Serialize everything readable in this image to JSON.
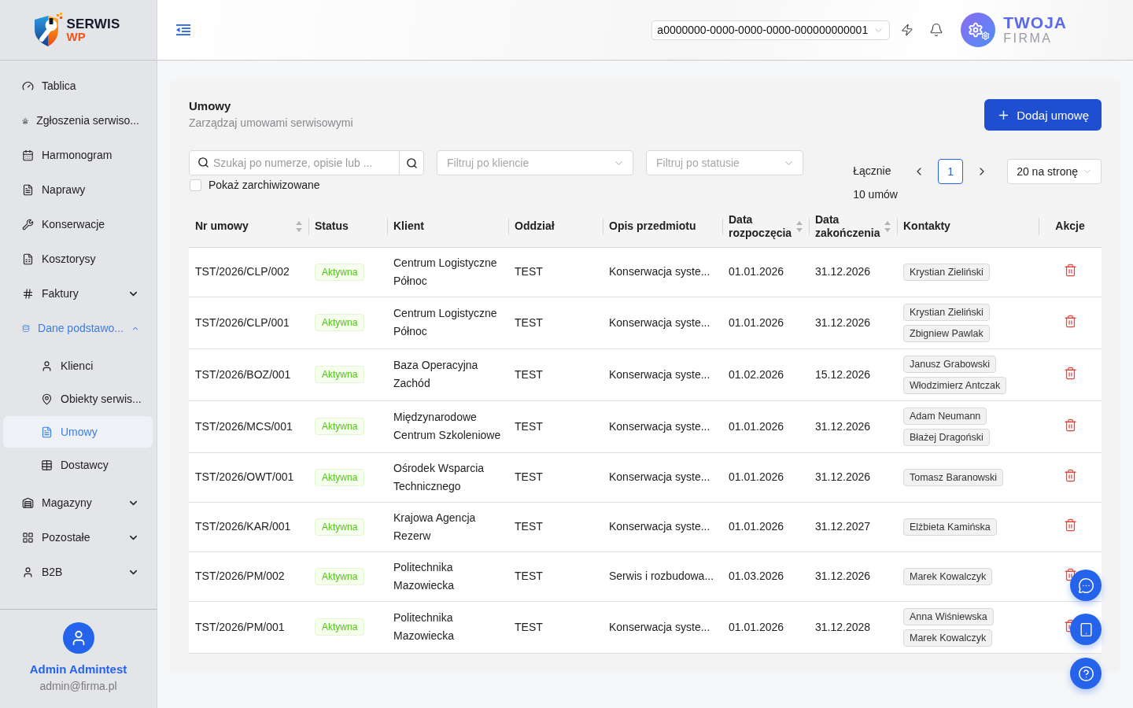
{
  "logo": {
    "title": "SERWIS",
    "subtitle": "WP"
  },
  "sidebar": {
    "items": [
      {
        "label": "Tablica",
        "kind": "link",
        "selected": false
      },
      {
        "label": "Zgłoszenia serwiso...",
        "kind": "link",
        "selected": false
      },
      {
        "label": "Harmonogram",
        "kind": "link",
        "selected": false
      },
      {
        "label": "Naprawy",
        "kind": "link",
        "selected": false
      },
      {
        "label": "Konserwacje",
        "kind": "link",
        "selected": false
      },
      {
        "label": "Kosztorysy",
        "kind": "link",
        "selected": false
      },
      {
        "label": "Faktury",
        "kind": "group",
        "expanded": false,
        "selected": false
      },
      {
        "label": "Dane podstawo...",
        "kind": "group",
        "expanded": true,
        "selected": false,
        "children": [
          {
            "label": "Klienci",
            "selected": false
          },
          {
            "label": "Obiekty serwis...",
            "selected": false
          },
          {
            "label": "Umowy",
            "selected": true
          },
          {
            "label": "Dostawcy",
            "selected": false
          }
        ]
      },
      {
        "label": "Magazyny",
        "kind": "group",
        "expanded": false,
        "selected": false
      },
      {
        "label": "Pozostałe",
        "kind": "group",
        "expanded": false,
        "selected": false
      },
      {
        "label": "B2B",
        "kind": "group",
        "expanded": false,
        "selected": false
      }
    ]
  },
  "user": {
    "name": "Admin Admintest",
    "email": "admin@firma.pl"
  },
  "header": {
    "tenant_select": {
      "value": "a0000000-0000-0000-0000-000000000001"
    },
    "company": {
      "title": "TWOJA",
      "subtitle": "FIRMA"
    }
  },
  "page": {
    "title": "Umowy",
    "subtitle": "Zarządzaj umowami serwisowymi",
    "add_button": "Dodaj umowę"
  },
  "filters": {
    "search": {
      "placeholder": "Szukaj po numerze, opisie lub ..."
    },
    "client": {
      "placeholder": "Filtruj po kliencie"
    },
    "status": {
      "placeholder": "Filtruj po statusie"
    },
    "show_archived": {
      "label": "Pokaż zarchiwizowane",
      "checked": false
    }
  },
  "pagination": {
    "total": "Łącznie 10 umów",
    "pages": [
      {
        "label": "1",
        "selected": true
      }
    ],
    "page_size": "20 na stronę"
  },
  "table": {
    "columns": [
      {
        "label": "Nr umowy",
        "sortable": true
      },
      {
        "label": "Status",
        "sortable": false
      },
      {
        "label": "Klient",
        "sortable": false
      },
      {
        "label": "Oddział",
        "sortable": false
      },
      {
        "label": "Opis przedmiotu",
        "sortable": false
      },
      {
        "label": "Data rozpoczęcia",
        "sortable": true
      },
      {
        "label": "Data zakończenia",
        "sortable": true
      },
      {
        "label": "Kontakty",
        "sortable": false
      },
      {
        "label": "Akcje",
        "sortable": false
      }
    ],
    "rows": [
      {
        "number": "TST/2026/CLP/002",
        "status": {
          "label": "Aktywna",
          "kind": "active"
        },
        "client": "Centrum Logistyczne Północ",
        "branch": "TEST",
        "description": "Konserwacja syste...",
        "start_date": "01.01.2026",
        "end_date": "31.12.2026",
        "contacts": [
          "Krystian Zieliński"
        ]
      },
      {
        "number": "TST/2026/CLP/001",
        "status": {
          "label": "Aktywna",
          "kind": "active"
        },
        "client": "Centrum Logistyczne Północ",
        "branch": "TEST",
        "description": "Konserwacja syste...",
        "start_date": "01.01.2026",
        "end_date": "31.12.2026",
        "contacts": [
          "Krystian Zieliński",
          "Zbigniew Pawlak"
        ]
      },
      {
        "number": "TST/2026/BOZ/001",
        "status": {
          "label": "Aktywna",
          "kind": "active"
        },
        "client": "Baza Operacyjna Zachód",
        "branch": "TEST",
        "description": "Konserwacja syste...",
        "start_date": "01.02.2026",
        "end_date": "15.12.2026",
        "contacts": [
          "Janusz Grabowski",
          "Włodzimierz Antczak"
        ]
      },
      {
        "number": "TST/2026/MCS/001",
        "status": {
          "label": "Aktywna",
          "kind": "active"
        },
        "client": "Międzynarodowe Centrum Szkoleniowe",
        "branch": "TEST",
        "description": "Konserwacja syste...",
        "start_date": "01.01.2026",
        "end_date": "31.12.2026",
        "contacts": [
          "Adam Neumann",
          "Błażej Dragoński"
        ]
      },
      {
        "number": "TST/2026/OWT/001",
        "status": {
          "label": "Aktywna",
          "kind": "active"
        },
        "client": "Ośrodek Wsparcia Technicznego",
        "branch": "TEST",
        "description": "Konserwacja syste...",
        "start_date": "01.01.2026",
        "end_date": "31.12.2026",
        "contacts": [
          "Tomasz Baranowski"
        ]
      },
      {
        "number": "TST/2026/KAR/001",
        "status": {
          "label": "Aktywna",
          "kind": "active"
        },
        "client": "Krajowa Agencja Rezerw",
        "branch": "TEST",
        "description": "Konserwacja syste...",
        "start_date": "01.01.2026",
        "end_date": "31.12.2027",
        "contacts": [
          "Elżbieta Kamińska"
        ]
      },
      {
        "number": "TST/2026/PM/002",
        "status": {
          "label": "Aktywna",
          "kind": "active"
        },
        "client": "Politechnika Mazowiecka",
        "branch": "TEST",
        "description": "Serwis i rozbudowa...",
        "start_date": "01.03.2026",
        "end_date": "31.12.2026",
        "contacts": [
          "Marek Kowalczyk"
        ]
      },
      {
        "number": "TST/2026/PM/001",
        "status": {
          "label": "Aktywna",
          "kind": "active"
        },
        "client": "Politechnika Mazowiecka",
        "branch": "TEST",
        "description": "Konserwacja syste...",
        "start_date": "01.01.2026",
        "end_date": "31.12.2028",
        "contacts": [
          "Anna Wiśniewska",
          "Marek Kowalczyk"
        ]
      }
    ]
  }
}
